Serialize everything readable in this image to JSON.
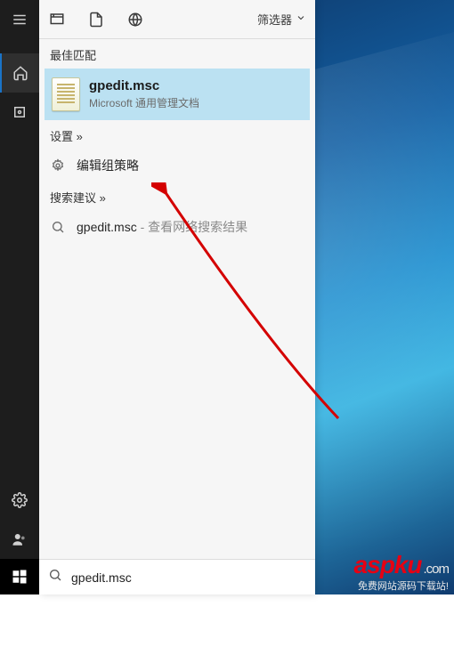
{
  "filter_label": "筛选器",
  "sections": {
    "best_match": "最佳匹配",
    "settings": "设置 »",
    "suggestions": "搜索建议 »"
  },
  "best_match_item": {
    "title": "gpedit.msc",
    "subtitle": "Microsoft 通用管理文档"
  },
  "settings_item": "编辑组策略",
  "suggestion": {
    "primary": "gpedit.msc",
    "suffix": " - 查看网络搜索结果"
  },
  "search_value": "gpedit.msc",
  "watermark": {
    "logo_main": "aspku",
    "logo_suffix": ".com",
    "tagline": "免费网站源码下载站!"
  }
}
